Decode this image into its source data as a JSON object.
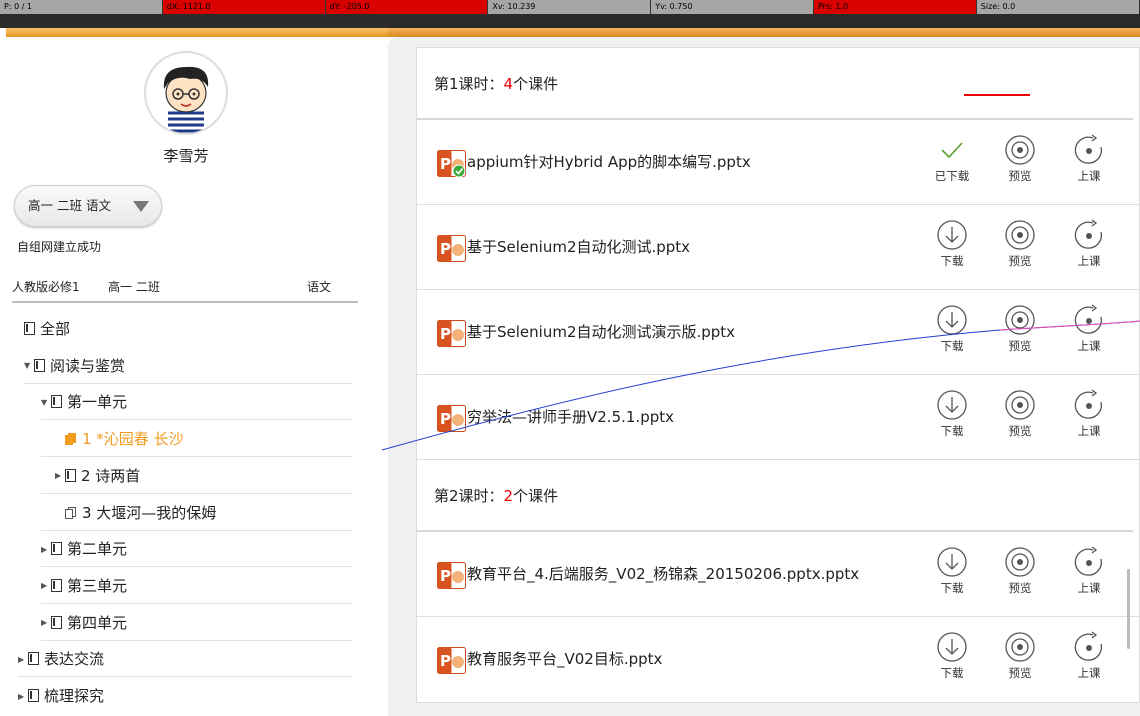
{
  "debug": {
    "pointer": "P: 0 / 1",
    "dx": "dX: 1121.0",
    "dy": "dY: -205.0",
    "xv": "Xv: 10.239",
    "yv": "Yv: 0.750",
    "prs": "Prs: 1.0",
    "size": "Size: 0.0"
  },
  "colors": {
    "accent": "#f19b1f",
    "count": "#ee0000",
    "underline": "#ee0000",
    "panel": "#f0f0f0"
  },
  "sidebar": {
    "teacher_name": "李雪芳",
    "class_select": "高一 二班 语文",
    "network_status": "自组网建立成功",
    "textbook": "人教版必修1",
    "class": "高一 二班",
    "subject": "语文",
    "tree": [
      {
        "label": "全部",
        "icon": "book-icon",
        "arrow": ""
      },
      {
        "label": "阅读与鉴赏",
        "icon": "book-icon",
        "arrow": "expanded"
      },
      {
        "label": "第一单元",
        "icon": "book-icon",
        "arrow": "expanded"
      },
      {
        "label": "1 *沁园春 长沙",
        "icon": "pages-icon",
        "arrow": "",
        "active": true
      },
      {
        "label": "2 诗两首",
        "icon": "book-icon",
        "arrow": "collapsed"
      },
      {
        "label": "3 大堰河—我的保姆",
        "icon": "pages-icon",
        "arrow": ""
      },
      {
        "label": "第二单元",
        "icon": "book-icon",
        "arrow": "collapsed"
      },
      {
        "label": "第三单元",
        "icon": "book-icon",
        "arrow": "collapsed"
      },
      {
        "label": "第四单元",
        "icon": "book-icon",
        "arrow": "collapsed"
      },
      {
        "label": "表达交流",
        "icon": "book-icon",
        "arrow": "collapsed"
      },
      {
        "label": "梳理探究",
        "icon": "book-icon",
        "arrow": "collapsed"
      }
    ]
  },
  "lessons": [
    {
      "title_prefix": "第1课时：",
      "count": "4",
      "title_suffix": "个课件",
      "files": [
        {
          "name": "appium针对Hybrid App的脚本编写.pptx",
          "downloaded": true,
          "download_label": "已下载",
          "preview_label": "预览",
          "teach_label": "上课"
        },
        {
          "name": "基于Selenium2自动化测试.pptx",
          "downloaded": false,
          "download_label": "下载",
          "preview_label": "预览",
          "teach_label": "上课"
        },
        {
          "name": "基于Selenium2自动化测试演示版.pptx",
          "downloaded": false,
          "download_label": "下载",
          "preview_label": "预览",
          "teach_label": "上课"
        },
        {
          "name": "穷举法—讲师手册V2.5.1.pptx",
          "downloaded": false,
          "download_label": "下载",
          "preview_label": "预览",
          "teach_label": "上课"
        }
      ]
    },
    {
      "title_prefix": "第2课时：",
      "count": "2",
      "title_suffix": "个课件",
      "files": [
        {
          "name": "教育平台_4.后端服务_V02_杨锦森_20150206.pptx.pptx",
          "downloaded": false,
          "download_label": "下载",
          "preview_label": "预览",
          "teach_label": "上课"
        },
        {
          "name": "教育服务平台_V02目标.pptx",
          "downloaded": false,
          "download_label": "下载",
          "preview_label": "预览",
          "teach_label": "上课"
        }
      ]
    }
  ]
}
